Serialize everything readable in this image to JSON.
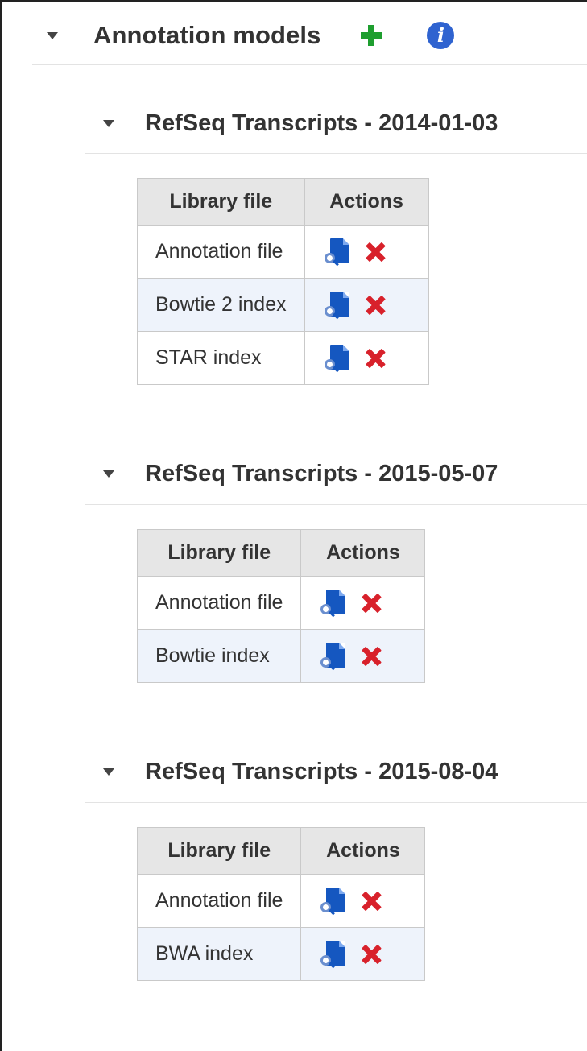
{
  "annotation_models": {
    "title": "Annotation models",
    "toggle_icon": "caret-down-icon",
    "add_icon": "plus-icon",
    "info_icon": "info-icon",
    "info_label": "i",
    "colors": {
      "add": "#1e9e2f",
      "info": "#2f63d0",
      "view_icon": "#1557c0",
      "delete_icon": "#d8212b",
      "header_bg": "#e6e6e6",
      "alt_row_bg": "#eef3fb"
    }
  },
  "groups": [
    {
      "title": "RefSeq Transcripts - 2014-01-03",
      "table_headers": {
        "library_file": "Library file",
        "actions": "Actions"
      },
      "rows": [
        {
          "file": "Annotation file",
          "view_icon": "view-file-icon",
          "delete_icon": "delete-icon"
        },
        {
          "file": "Bowtie 2 index",
          "view_icon": "view-file-icon",
          "delete_icon": "delete-icon"
        },
        {
          "file": "STAR index",
          "view_icon": "view-file-icon",
          "delete_icon": "delete-icon"
        }
      ]
    },
    {
      "title": "RefSeq Transcripts - 2015-05-07",
      "table_headers": {
        "library_file": "Library file",
        "actions": "Actions"
      },
      "rows": [
        {
          "file": "Annotation file",
          "view_icon": "view-file-icon",
          "delete_icon": "delete-icon"
        },
        {
          "file": "Bowtie index",
          "view_icon": "view-file-icon",
          "delete_icon": "delete-icon"
        }
      ]
    },
    {
      "title": "RefSeq Transcripts - 2015-08-04",
      "table_headers": {
        "library_file": "Library file",
        "actions": "Actions"
      },
      "rows": [
        {
          "file": "Annotation file",
          "view_icon": "view-file-icon",
          "delete_icon": "delete-icon"
        },
        {
          "file": "BWA index",
          "view_icon": "view-file-icon",
          "delete_icon": "delete-icon"
        }
      ]
    }
  ]
}
